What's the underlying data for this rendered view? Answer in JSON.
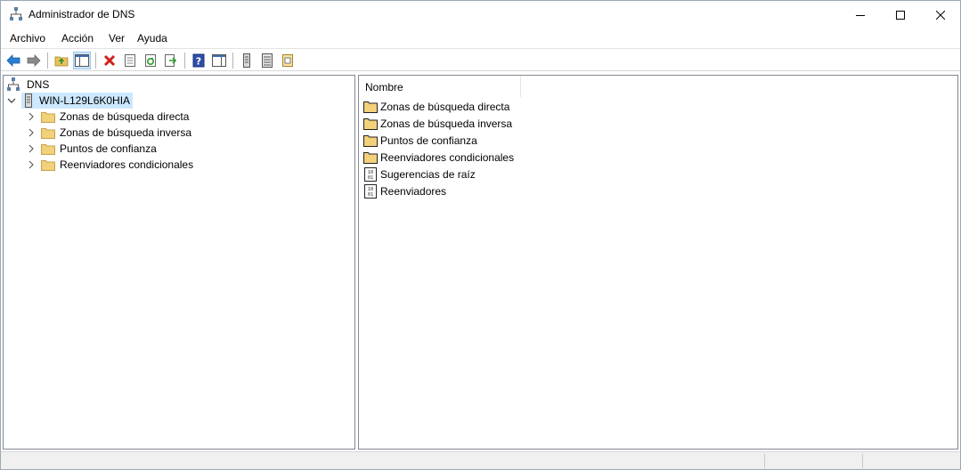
{
  "window": {
    "title": "Administrador de DNS"
  },
  "menu": [
    "Archivo",
    "Acción",
    "Ver",
    "Ayuda"
  ],
  "toolbar": {
    "buttons": [
      "back-icon",
      "forward-icon",
      "up-folder-icon",
      "show-hide-tree-icon",
      "delete-icon",
      "properties-icon",
      "refresh-icon",
      "export-list-icon",
      "help-icon",
      "action-pane-icon",
      "server-icon",
      "zone-list-icon",
      "new-zone-icon"
    ]
  },
  "tree": {
    "root": "DNS",
    "server": "WIN-L129L6K0HIA",
    "children": [
      "Zonas de búsqueda directa",
      "Zonas de búsqueda inversa",
      "Puntos de confianza",
      "Reenviadores condicionales"
    ]
  },
  "list": {
    "header": "Nombre",
    "items": [
      {
        "label": "Zonas de búsqueda directa",
        "icon": "folder-icon"
      },
      {
        "label": "Zonas de búsqueda inversa",
        "icon": "folder-icon"
      },
      {
        "label": "Puntos de confianza",
        "icon": "folder-icon"
      },
      {
        "label": "Reenviadores condicionales",
        "icon": "folder-icon"
      },
      {
        "label": "Sugerencias de raíz",
        "icon": "binary-file-icon"
      },
      {
        "label": "Reenviadores",
        "icon": "binary-file-icon"
      }
    ]
  },
  "colors": {
    "selection": "#cce8ff",
    "folder": "#f3d07a",
    "accent": "#0078d7"
  }
}
